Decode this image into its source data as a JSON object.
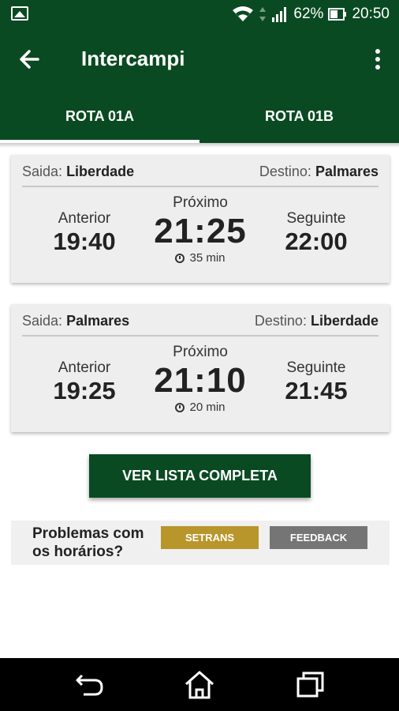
{
  "status": {
    "battery": "62%",
    "time": "20:50"
  },
  "appbar": {
    "title": "Intercampi"
  },
  "tabs": [
    {
      "label": "ROTA 01A",
      "active": true
    },
    {
      "label": "ROTA 01B",
      "active": false
    }
  ],
  "cards": [
    {
      "departure_label": "Saida:",
      "departure": "Liberdade",
      "destination_label": "Destino:",
      "destination": "Palmares",
      "previous_label": "Anterior",
      "previous": "19:40",
      "next_label": "Próximo",
      "next": "21:25",
      "next_in": "35 min",
      "following_label": "Seguinte",
      "following": "22:00"
    },
    {
      "departure_label": "Saida:",
      "departure": "Palmares",
      "destination_label": "Destino:",
      "destination": "Liberdade",
      "previous_label": "Anterior",
      "previous": "19:25",
      "next_label": "Próximo",
      "next": "21:10",
      "next_in": "20 min",
      "following_label": "Seguinte",
      "following": "21:45"
    }
  ],
  "full_list_button": "VER LISTA COMPLETA",
  "problems": {
    "text_line1": "Problemas com",
    "text_line2": "os horários?",
    "setrans_button": "SETRANS",
    "feedback_button": "FEEDBACK"
  },
  "colors": {
    "primary": "#0a4a22",
    "setrans": "#b8962c",
    "feedback": "#757575"
  },
  "icons": [
    "image-icon",
    "wifi-icon",
    "signal-icon",
    "battery-icon",
    "back-arrow-icon",
    "more-vert-icon",
    "clock-icon",
    "nav-back-icon",
    "nav-home-icon",
    "nav-recents-icon"
  ]
}
